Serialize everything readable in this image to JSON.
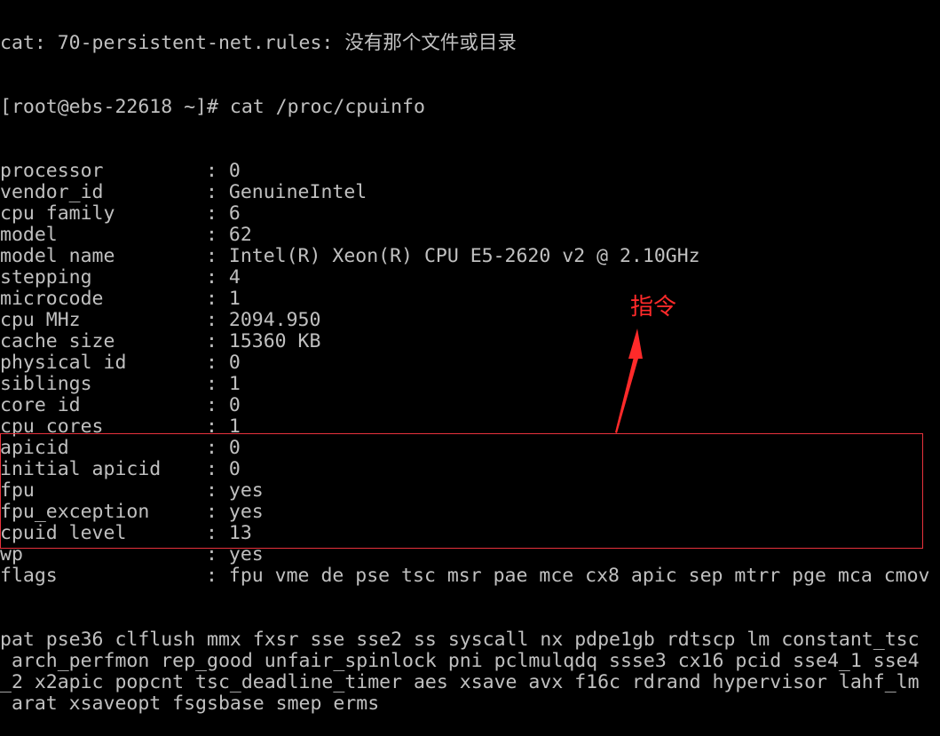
{
  "terminal": {
    "partial_top_line": "cat: 70-persistent-net.rules: 没有那个文件或目录",
    "prompt": "[root@ebs-22618 ~]# cat /proc/cpuinfo",
    "fields": [
      {
        "key": "processor",
        "value": "0"
      },
      {
        "key": "vendor_id",
        "value": "GenuineIntel"
      },
      {
        "key": "cpu family",
        "value": "6"
      },
      {
        "key": "model",
        "value": "62"
      },
      {
        "key": "model name",
        "value": "Intel(R) Xeon(R) CPU E5-2620 v2 @ 2.10GHz"
      },
      {
        "key": "stepping",
        "value": "4"
      },
      {
        "key": "microcode",
        "value": "1"
      },
      {
        "key": "cpu MHz",
        "value": "2094.950"
      },
      {
        "key": "cache size",
        "value": "15360 KB"
      },
      {
        "key": "physical id",
        "value": "0"
      },
      {
        "key": "siblings",
        "value": "1"
      },
      {
        "key": "core id",
        "value": "0"
      },
      {
        "key": "cpu cores",
        "value": "1"
      },
      {
        "key": "apicid",
        "value": "0"
      },
      {
        "key": "initial apicid",
        "value": "0"
      },
      {
        "key": "fpu",
        "value": "yes"
      },
      {
        "key": "fpu_exception",
        "value": "yes"
      },
      {
        "key": "cpuid level",
        "value": "13"
      },
      {
        "key": "wp",
        "value": "yes"
      },
      {
        "key": "flags",
        "value": "fpu vme de pse tsc msr pae mce cx8 apic sep mtrr pge mca cmov"
      }
    ],
    "flags_wrapped_lines": [
      "pat pse36 clflush mmx fxsr sse sse2 ss syscall nx pdpe1gb rdtscp lm constant_tsc",
      " arch_perfmon rep_good unfair_spinlock pni pclmulqdq ssse3 cx16 pcid sse4_1 sse4",
      "_2 x2apic popcnt tsc_deadline_timer aes xsave avx f16c rdrand hypervisor lahf_lm",
      " arat xsaveopt fsgsbase smep erms"
    ],
    "separator": ": "
  },
  "annotation": {
    "label": "指令",
    "color": "#ff2a2a"
  },
  "colors": {
    "background": "#000000",
    "text": "#c0c0c0",
    "highlight_border": "#e8323c"
  }
}
